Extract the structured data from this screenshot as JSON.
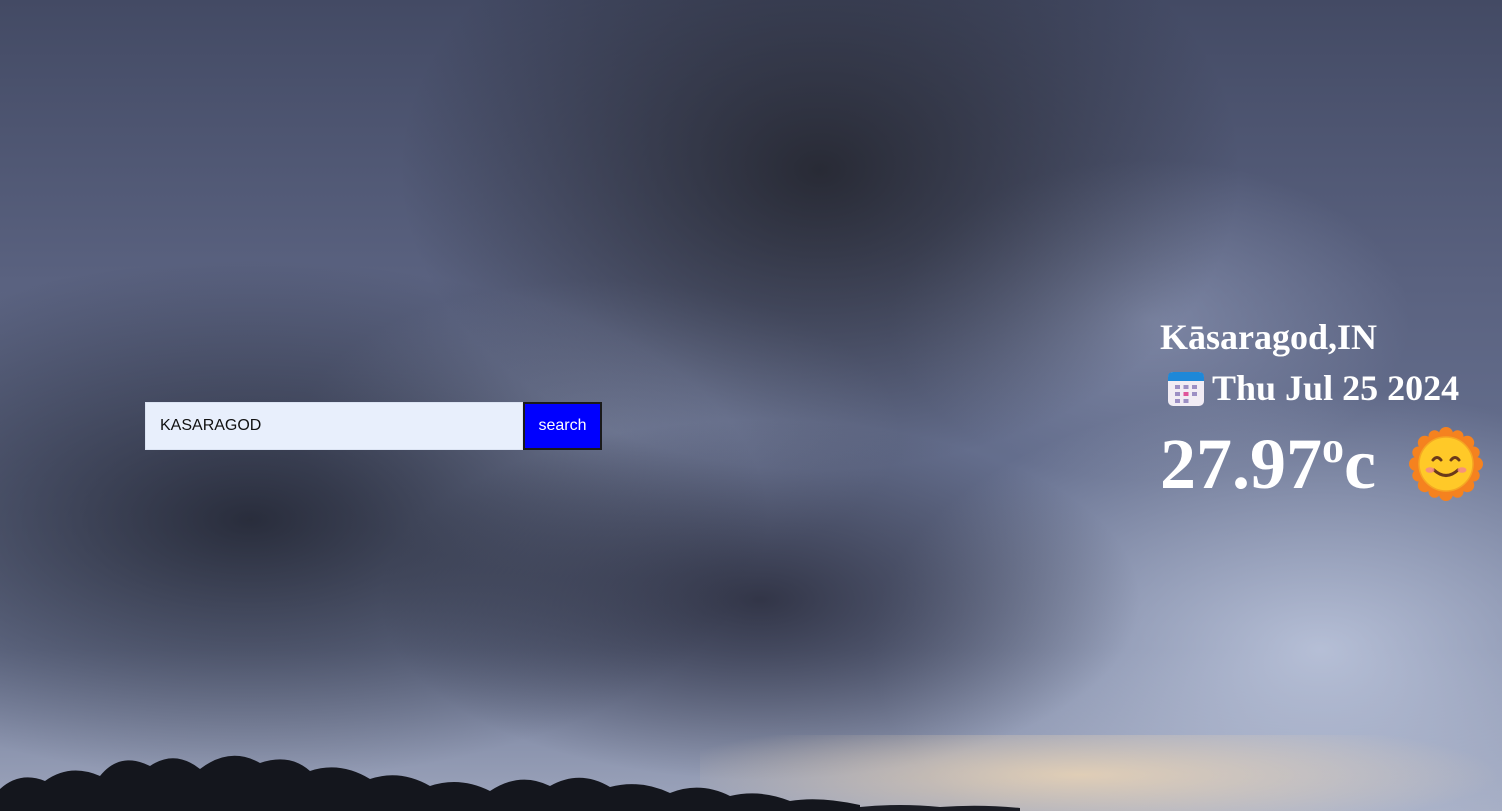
{
  "search": {
    "value": "KASARAGOD",
    "button_label": "search"
  },
  "weather": {
    "city": "Kāsaragod,IN",
    "date": "Thu Jul 25 2024",
    "temperature": "27.97",
    "degree_symbol": "o",
    "unit": "c",
    "date_icon": "calendar-icon",
    "condition_icon": "smiling-sun-icon"
  },
  "colors": {
    "button_bg": "#0000ff",
    "input_bg": "#e8effc",
    "text": "#ffffff"
  }
}
